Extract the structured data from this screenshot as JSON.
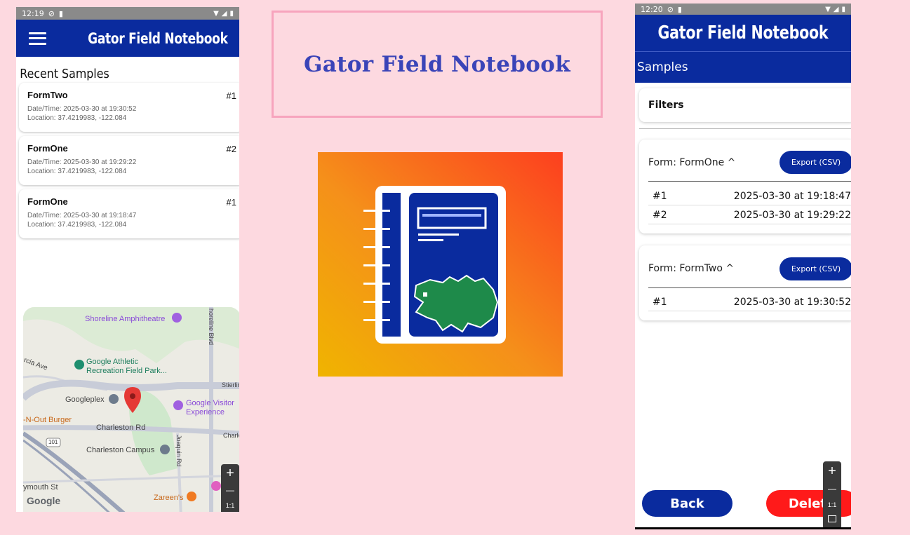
{
  "left_phone": {
    "status": {
      "time": "12:19"
    },
    "app_title": "Gator Field Notebook",
    "section_title": "Recent Samples",
    "samples": [
      {
        "name": "FormTwo",
        "num": "#1",
        "datetime": "Date/Time: 2025-03-30 at 19:30:52",
        "location": "Location: 37.4219983, -122.084"
      },
      {
        "name": "FormOne",
        "num": "#2",
        "datetime": "Date/Time: 2025-03-30 at 19:29:22",
        "location": "Location: 37.4219983, -122.084"
      },
      {
        "name": "FormOne",
        "num": "#1",
        "datetime": "Date/Time: 2025-03-30 at 19:18:47",
        "location": "Location: 37.4219983, -122.084"
      }
    ],
    "map": {
      "labels": {
        "shoreline": "Shoreline Amphitheatre",
        "athletic1": "Google Athletic",
        "athletic2": "Recreation Field Park...",
        "googleplex": "Googleplex",
        "visitor1": "Google Visitor",
        "visitor2": "Experience",
        "innout": "-N-Out Burger",
        "charleston_rd": "Charleston Rd",
        "campus": "Charleston Campus",
        "plymouth": "ymouth St",
        "zareens": "Zareen's",
        "shoreline_blvd": "horeline Blvd",
        "joaquin": "Joaquin Rd",
        "garcia": "rcia Ave",
        "stierlin": "Stierlin",
        "charle": "Charle",
        "hwy": "101",
        "google": "Google"
      },
      "zoom": {
        "plus": "+",
        "minus": "—",
        "ratio": "1:1"
      }
    }
  },
  "banner": {
    "title": "Gator Field Notebook"
  },
  "right_phone": {
    "status": {
      "time": "12:20"
    },
    "app_title": "Gator Field Notebook",
    "samples_header": "Samples",
    "filters_label": "Filters",
    "forms": [
      {
        "header": "Form: FormOne ^",
        "export_label": "Export (CSV)",
        "rows": [
          {
            "num": "#1",
            "datetime": "2025-03-30 at 19:18:47"
          },
          {
            "num": "#2",
            "datetime": "2025-03-30 at 19:29:22"
          }
        ]
      },
      {
        "header": "Form: FormTwo ^",
        "export_label": "Export (CSV)",
        "rows": [
          {
            "num": "#1",
            "datetime": "2025-03-30 at 19:30:52"
          }
        ]
      }
    ],
    "back_label": "Back",
    "delete_label": "Delete",
    "zoom": {
      "plus": "+",
      "minus": "—",
      "ratio": "1:1"
    }
  },
  "colors": {
    "background": "#fdd9e0",
    "appbar": "#0a2b9e",
    "delete": "#ff1a1a",
    "banner_text": "#3a44b8",
    "banner_border": "#f7a4bd"
  }
}
